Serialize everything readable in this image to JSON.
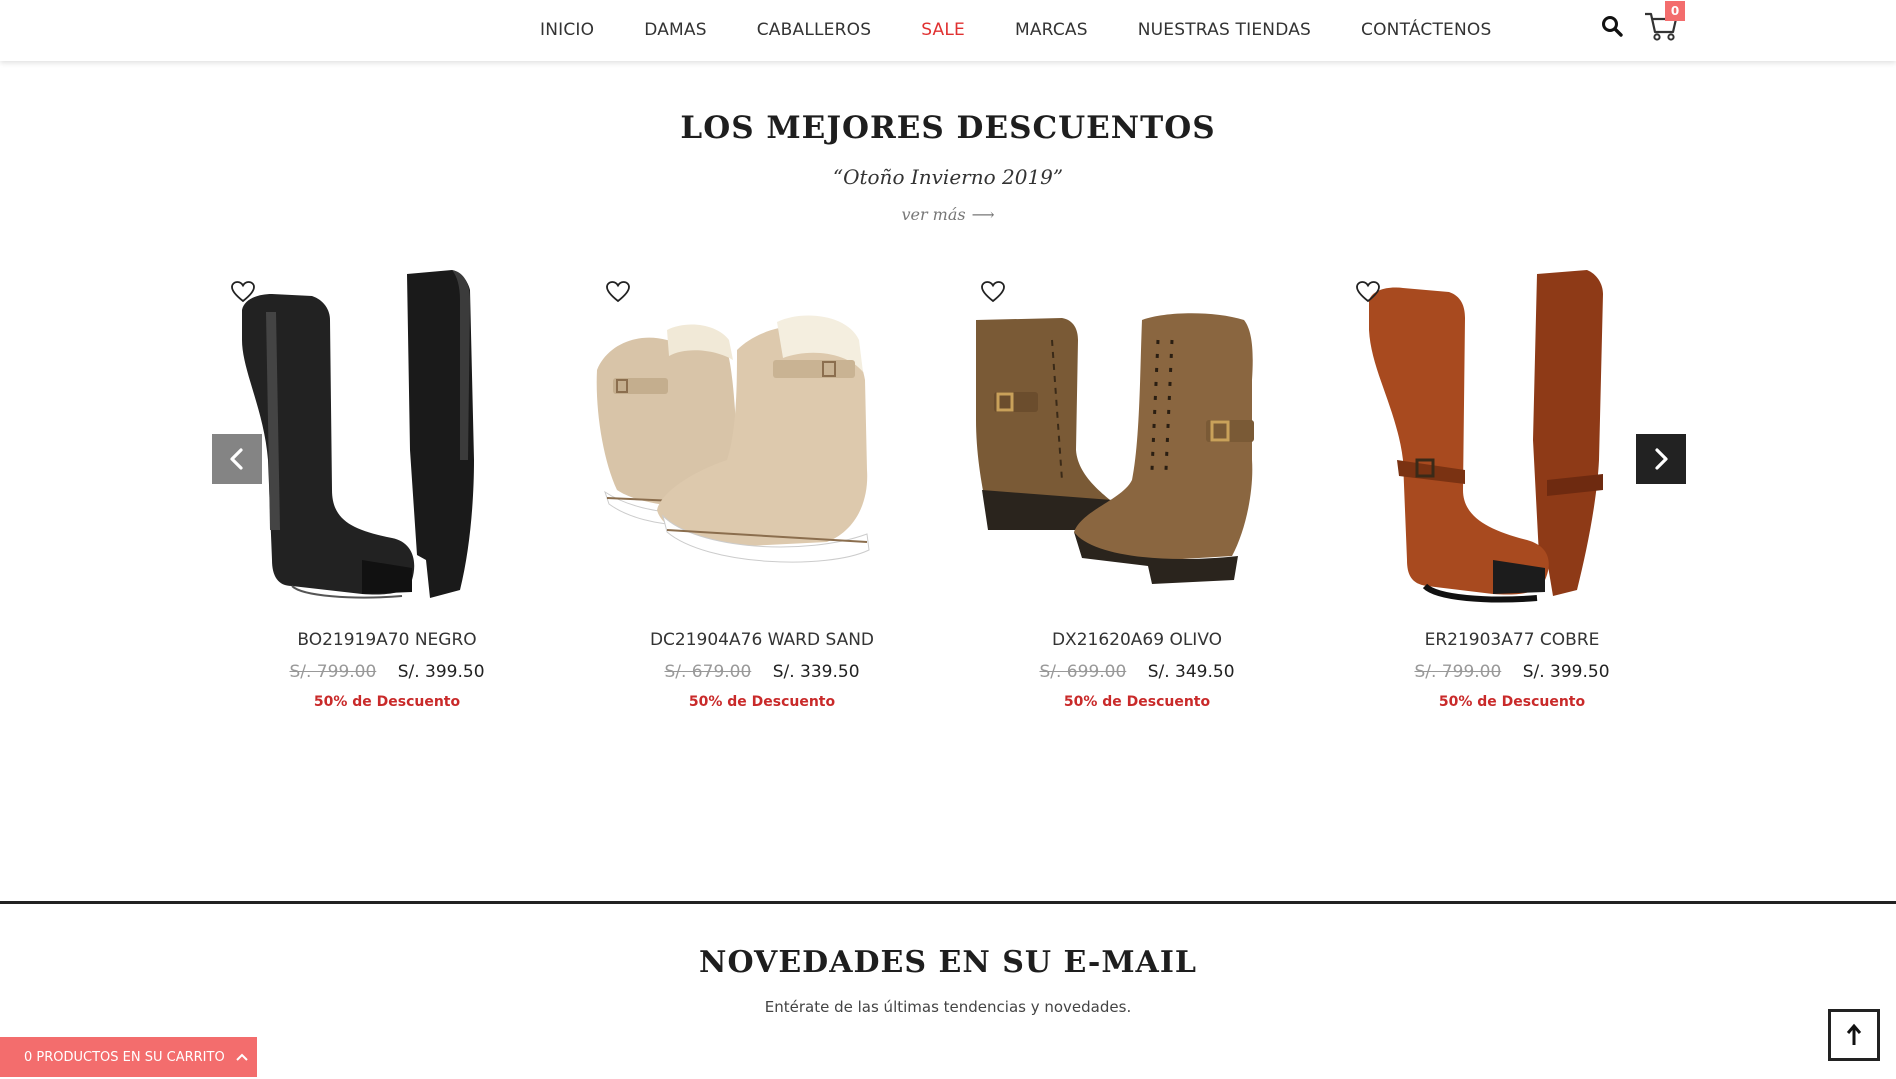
{
  "nav": {
    "items": [
      {
        "label": "INICIO",
        "active": false
      },
      {
        "label": "DAMAS",
        "active": false
      },
      {
        "label": "CABALLEROS",
        "active": false
      },
      {
        "label": "SALE",
        "active": true
      },
      {
        "label": "MARCAS",
        "active": false
      },
      {
        "label": "NUESTRAS TIENDAS",
        "active": false
      },
      {
        "label": "CONTÁCTENOS",
        "active": false
      }
    ],
    "cart_count": "0",
    "icons": {
      "search": "search-icon",
      "cart": "cart-icon"
    }
  },
  "section": {
    "title": "LOS MEJORES DESCUENTOS",
    "subtitle": "“Otoño Invierno 2019”",
    "link": "ver más",
    "link_arrow": "⟶"
  },
  "products": [
    {
      "name": "BO21919A70 NEGRO",
      "old_price": "S/. 799.00",
      "price": "S/. 399.50",
      "discount": "50% de Descuento",
      "image": "black-tall-boot"
    },
    {
      "name": "DC21904A76 WARD SAND",
      "old_price": "S/. 679.00",
      "price": "S/. 339.50",
      "discount": "50% de Descuento",
      "image": "sand-shearling-ankle-boot"
    },
    {
      "name": "DX21620A69 OLIVO",
      "old_price": "S/. 699.00",
      "price": "S/. 349.50",
      "discount": "50% de Descuento",
      "image": "olive-lace-up-boot"
    },
    {
      "name": "ER21903A77 COBRE",
      "old_price": "S/. 799.00",
      "price": "S/. 399.50",
      "discount": "50% de Descuento",
      "image": "copper-tall-boot"
    }
  ],
  "newsletter": {
    "title": "NOVEDADES EN SU E-MAIL",
    "subtitle": "Entérate de las últimas tendencias y novedades."
  },
  "cart_bar": {
    "label": "0 PRODUCTOS EN SU CARRITO"
  },
  "colors": {
    "accent": "#f36d6d",
    "sale": "#e03131",
    "discount": "#c92a2a"
  }
}
